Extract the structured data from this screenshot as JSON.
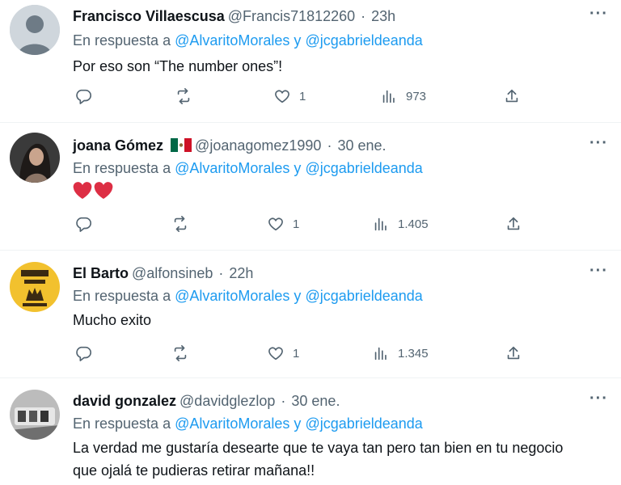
{
  "tweets": [
    {
      "name": "Francisco Villaescusa",
      "handle": "@Francis71812260",
      "time": "23h",
      "reply_prefix": "En respuesta a",
      "mention1": "@AlvaritoMorales",
      "reply_and": "y",
      "mention2": "@jcgabrieldeanda",
      "text": "Por eso son “The number ones”!",
      "likes": "1",
      "views": "973",
      "avatar": "default-avatar"
    },
    {
      "name": "joana Gómez",
      "handle": "@joanagomez1990",
      "time": "30 ene.",
      "reply_prefix": "En respuesta a",
      "mention1": "@AlvaritoMorales",
      "reply_and": "y",
      "mention2": "@jcgabrieldeanda",
      "text": "❤️❤️",
      "likes": "1",
      "views": "1.405",
      "avatar": "photo-avatar"
    },
    {
      "name": "El Barto",
      "handle": "@alfonsineb",
      "time": "22h",
      "reply_prefix": "En respuesta a",
      "mention1": "@AlvaritoMorales",
      "reply_and": "y",
      "mention2": "@jcgabrieldeanda",
      "text": "Mucho exito",
      "likes": "1",
      "views": "1.345",
      "avatar": "bart-avatar"
    },
    {
      "name": "david gonzalez",
      "handle": "@davidglezlop",
      "time": "30 ene.",
      "reply_prefix": "En respuesta a",
      "mention1": "@AlvaritoMorales",
      "reply_and": "y",
      "mention2": "@jcgabrieldeanda",
      "text": "La verdad me gustaría desearte que te vaya tan pero tan bien en tu negocio que ojalá te pudieras retirar mañana!!",
      "avatar": "photo-avatar"
    }
  ],
  "colors": {
    "link": "#1d9bf0",
    "muted": "#536471",
    "text": "#0f1419",
    "heart": "#e0245e"
  }
}
